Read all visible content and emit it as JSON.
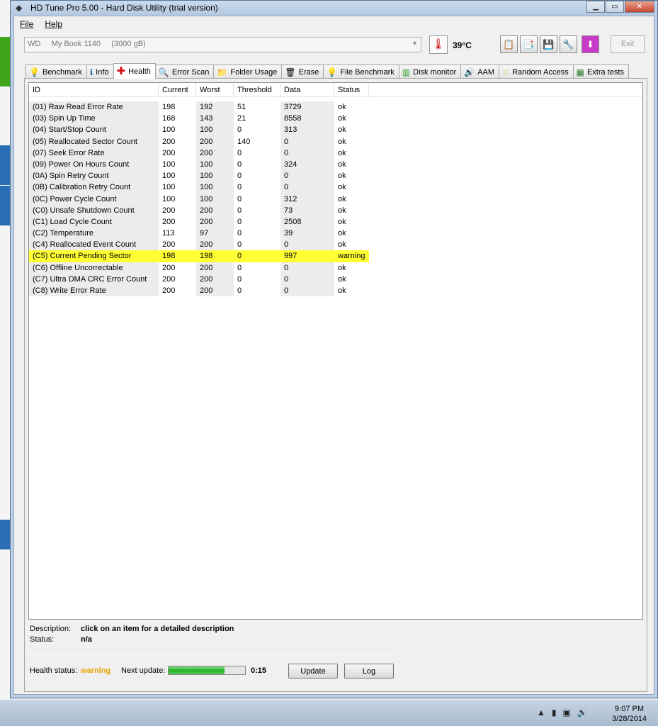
{
  "window": {
    "title": "HD Tune Pro 5.00 - Hard Disk Utility (trial version)",
    "controls": [
      "0",
      "1",
      "r"
    ]
  },
  "menu": [
    "File",
    "Help"
  ],
  "drive": {
    "selected": "WD     My Book 1140     (3000 gB)",
    "temperature": "39°C"
  },
  "toolbar": {
    "exit_label": "Exit"
  },
  "tabs": [
    {
      "label": "Benchmark",
      "icon": "benchmark-icon"
    },
    {
      "label": "Info",
      "icon": "info-icon"
    },
    {
      "label": "Health",
      "icon": "health-cross-icon"
    },
    {
      "label": "Error Scan",
      "icon": "magnifier-icon"
    },
    {
      "label": "Folder Usage",
      "icon": "folder-icon"
    },
    {
      "label": "Erase",
      "icon": "trash-icon"
    },
    {
      "label": "File Benchmark",
      "icon": "file-benchmark-icon"
    },
    {
      "label": "Disk monitor",
      "icon": "monitor-chart-icon"
    },
    {
      "label": "AAM",
      "icon": "speaker-icon"
    },
    {
      "label": "Random Access",
      "icon": "random-access-icon"
    },
    {
      "label": "Extra tests",
      "icon": "extra-tests-icon"
    }
  ],
  "active_tab": "Health",
  "table": {
    "columns": [
      "ID",
      "Current",
      "Worst",
      "Threshold",
      "Data",
      "Status"
    ],
    "rows": [
      [
        "(01) Raw Read Error Rate",
        "198",
        "192",
        "51",
        "3729",
        "ok"
      ],
      [
        "(03) Spin Up Time",
        "168",
        "143",
        "21",
        "8558",
        "ok"
      ],
      [
        "(04) Start/Stop Count",
        "100",
        "100",
        "0",
        "313",
        "ok"
      ],
      [
        "(05) Reallocated Sector Count",
        "200",
        "200",
        "140",
        "0",
        "ok"
      ],
      [
        "(07) Seek Error Rate",
        "200",
        "200",
        "0",
        "0",
        "ok"
      ],
      [
        "(09) Power On Hours Count",
        "100",
        "100",
        "0",
        "324",
        "ok"
      ],
      [
        "(0A) Spin Retry Count",
        "100",
        "100",
        "0",
        "0",
        "ok"
      ],
      [
        "(0B) Calibration Retry Count",
        "100",
        "100",
        "0",
        "0",
        "ok"
      ],
      [
        "(0C) Power Cycle Count",
        "100",
        "100",
        "0",
        "312",
        "ok"
      ],
      [
        "(C0) Unsafe Shutdown Count",
        "200",
        "200",
        "0",
        "73",
        "ok"
      ],
      [
        "(C1) Load Cycle Count",
        "200",
        "200",
        "0",
        "2508",
        "ok"
      ],
      [
        "(C2) Temperature",
        "113",
        "97",
        "0",
        "39",
        "ok"
      ],
      [
        "(C4) Reallocated Event Count",
        "200",
        "200",
        "0",
        "0",
        "ok"
      ],
      [
        "(C5) Current Pending Sector",
        "198",
        "198",
        "0",
        "997",
        "warning"
      ],
      [
        "(C6) Offline Uncorrectable",
        "200",
        "200",
        "0",
        "0",
        "ok"
      ],
      [
        "(C7) Ultra DMA CRC Error Count",
        "200",
        "200",
        "0",
        "0",
        "ok"
      ],
      [
        "(C8) Write Error Rate",
        "200",
        "200",
        "0",
        "0",
        "ok"
      ]
    ],
    "highlight_color": "#ffff33"
  },
  "description": {
    "desc_label": "Description:",
    "desc_value": "click on an item for a detailed description",
    "status_label": "Status:",
    "status_value": "n/a"
  },
  "health": {
    "label": "Health status:",
    "value": "warning",
    "value_color": "#e8a400",
    "next_update_label": "Next update:",
    "progress": 0.73,
    "countdown": "0:15",
    "update_button": "Update",
    "log_button": "Log"
  },
  "taskbar": {
    "time": "9:07 PM",
    "date": "3/28/2014"
  }
}
